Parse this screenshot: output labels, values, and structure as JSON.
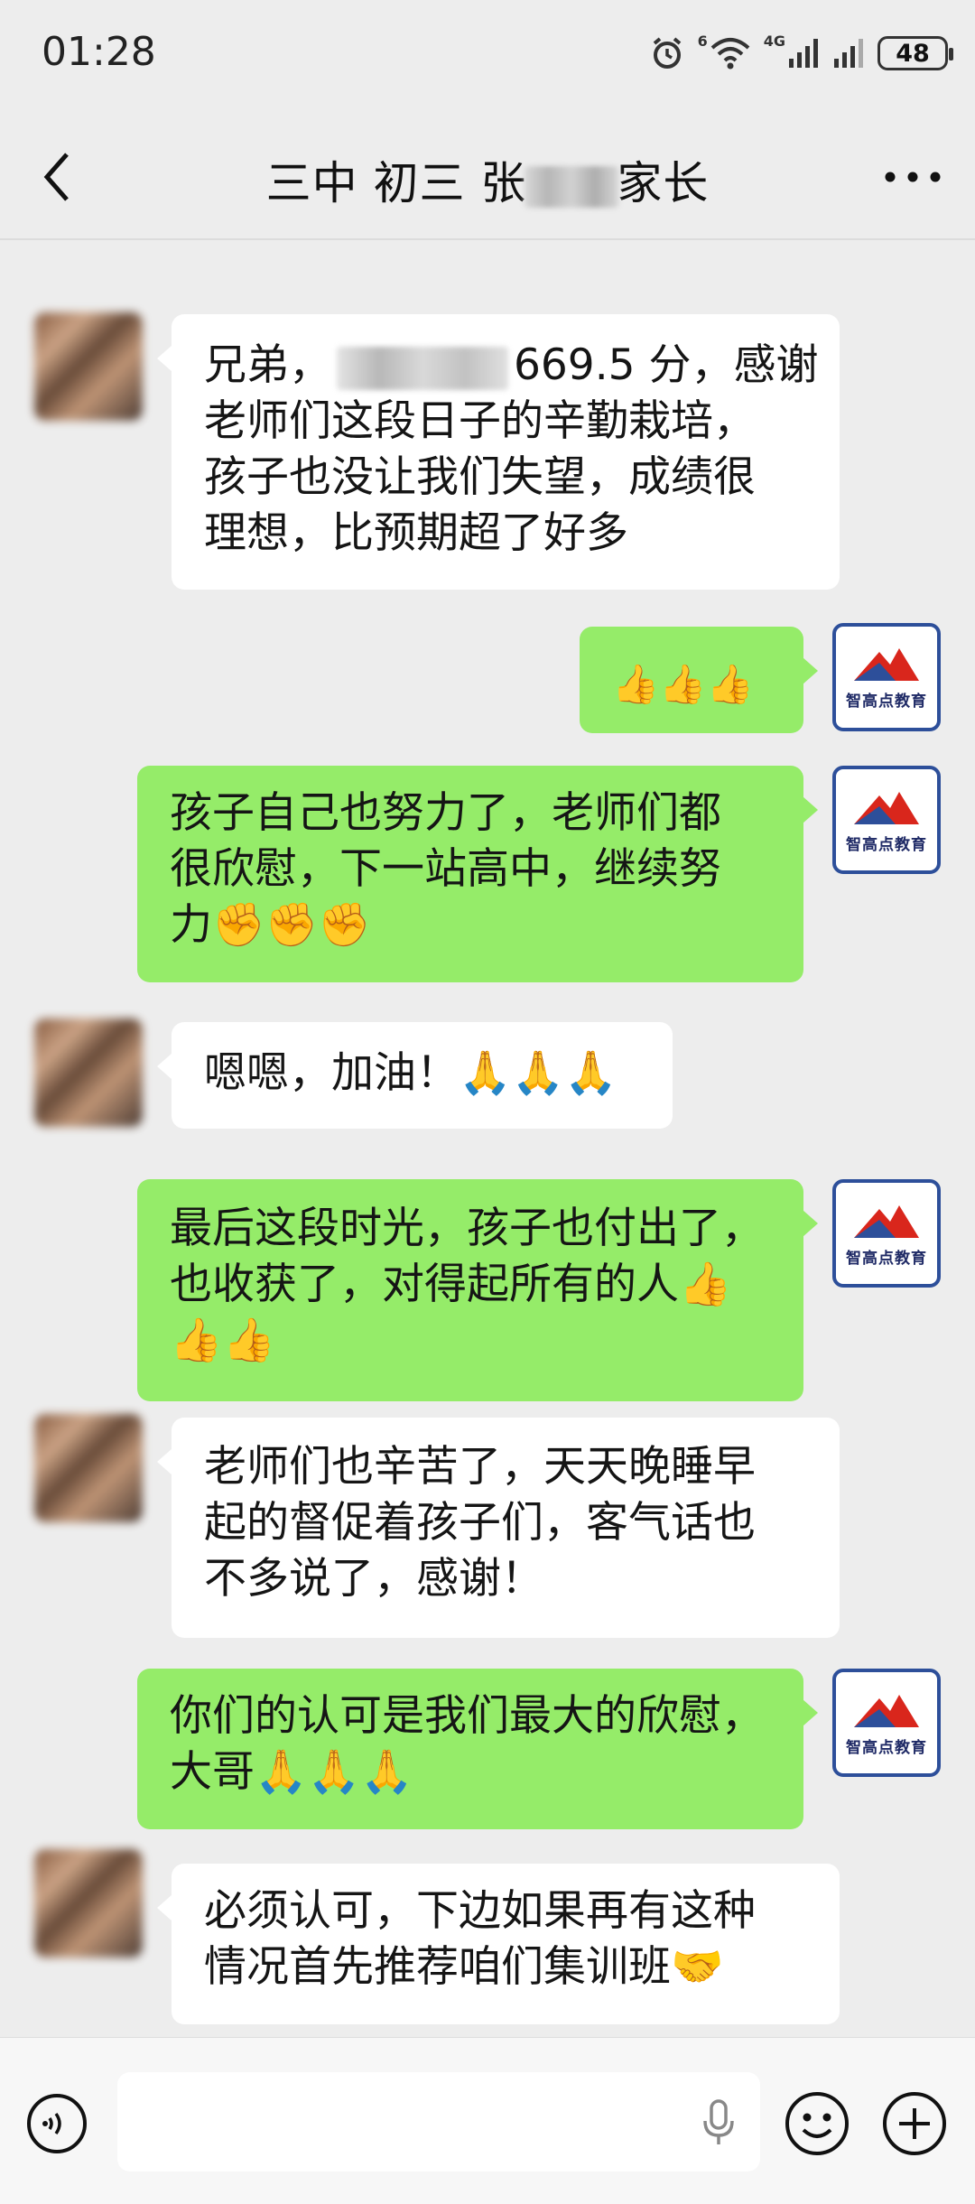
{
  "status_bar": {
    "time": "01:28",
    "network_label": "4G",
    "wifi_label": "6",
    "battery": "48"
  },
  "header": {
    "title_prefix": "三中 初三 张",
    "title_suffix": "家长"
  },
  "messages": [
    {
      "from": "other",
      "avatar": "blurred-avatar",
      "lines": [
        "兄弟，{redacted}669.5 分，感谢",
        "老师们这段日子的辛勤栽培，",
        "孩子也没让我们失望，成绩很",
        "理想，比预期超了好多"
      ]
    },
    {
      "from": "self",
      "avatar": "智高点教育",
      "lines": [
        "👍👍👍"
      ]
    },
    {
      "from": "self",
      "avatar": "智高点教育",
      "lines": [
        "孩子自己也努力了，老师们都",
        "很欣慰，下一站高中，继续努",
        "力✊✊✊"
      ]
    },
    {
      "from": "other",
      "avatar": "blurred-avatar",
      "lines": [
        "嗯嗯，加油！🙏🙏🙏"
      ]
    },
    {
      "from": "self",
      "avatar": "智高点教育",
      "lines": [
        "最后这段时光，孩子也付出了，",
        "也收获了，对得起所有的人👍",
        "👍👍"
      ]
    },
    {
      "from": "other",
      "avatar": "blurred-avatar",
      "lines": [
        "老师们也辛苦了，天天晚睡早",
        "起的督促着孩子们，客气话也",
        "不多说了，感谢！"
      ]
    },
    {
      "from": "self",
      "avatar": "智高点教育",
      "lines": [
        "你们的认可是我们最大的欣慰，",
        "大哥🙏🙏🙏"
      ]
    },
    {
      "from": "other",
      "avatar": "blurred-avatar",
      "lines": [
        "必须认可，下边如果再有这种",
        "情况首先推荐咱们集训班🤝"
      ]
    }
  ],
  "logo": {
    "name": "智高点教育"
  },
  "colors": {
    "self_bubble": "#95ec69",
    "other_bubble": "#ffffff",
    "background": "#ededed",
    "logo_red": "#d9261c",
    "logo_blue": "#2d4f9a"
  },
  "icons": {
    "back": "chevron-left-icon",
    "more": "more-dots-icon",
    "voice": "voice-input-icon",
    "mic": "microphone-icon",
    "emoji": "emoji-icon",
    "plus": "plus-icon"
  }
}
